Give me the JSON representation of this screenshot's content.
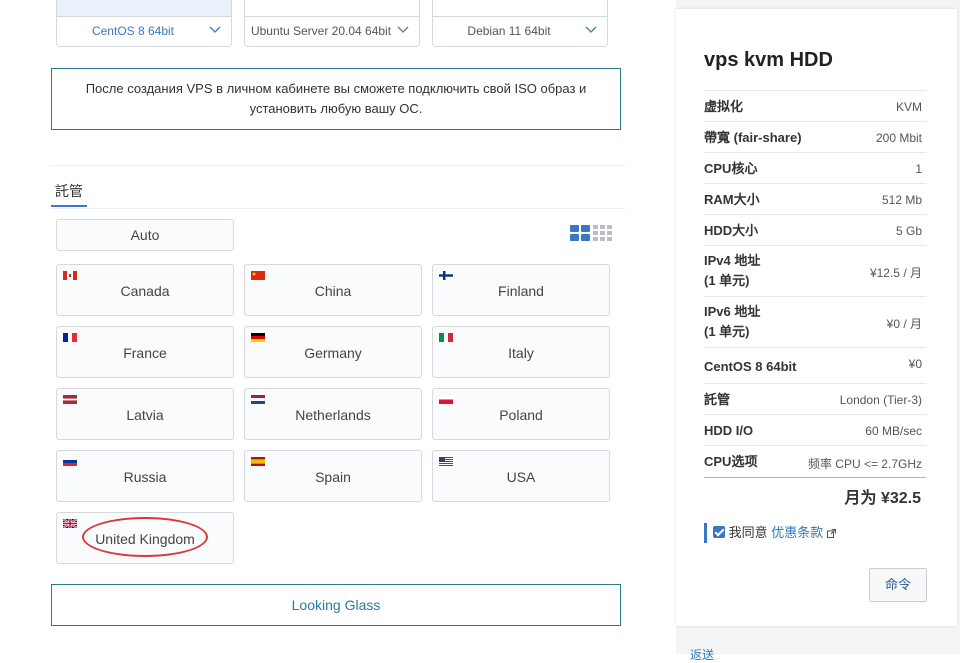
{
  "os_cards": [
    {
      "label": "CentOS 8 64bit",
      "selected": true
    },
    {
      "label": "Ubuntu Server 20.04 64bit",
      "selected": false
    },
    {
      "label": "Debian 11 64bit",
      "selected": false
    }
  ],
  "notice": "После создания VPS в личном кабинете вы сможете подключить свой ISO образ и установить любую вашу ОС.",
  "section_tab": "託管",
  "auto_label": "Auto",
  "locations": [
    {
      "name": "Canada",
      "flag": "canada-flag-icon"
    },
    {
      "name": "China",
      "flag": "china-flag-icon"
    },
    {
      "name": "Finland",
      "flag": "finland-flag-icon"
    },
    {
      "name": "France",
      "flag": "france-flag-icon"
    },
    {
      "name": "Germany",
      "flag": "germany-flag-icon"
    },
    {
      "name": "Italy",
      "flag": "italy-flag-icon"
    },
    {
      "name": "Latvia",
      "flag": "latvia-flag-icon"
    },
    {
      "name": "Netherlands",
      "flag": "netherlands-flag-icon"
    },
    {
      "name": "Poland",
      "flag": "poland-flag-icon"
    },
    {
      "name": "Russia",
      "flag": "russia-flag-icon"
    },
    {
      "name": "Spain",
      "flag": "spain-flag-icon"
    },
    {
      "name": "USA",
      "flag": "usa-flag-icon"
    },
    {
      "name": "United Kingdom",
      "flag": "uk-flag-icon"
    }
  ],
  "looking_glass": "Looking Glass",
  "summary": {
    "title": "vps kvm HDD",
    "rows": [
      {
        "k": "虚拟化",
        "v": "KVM"
      },
      {
        "k": "帶寬 (fair-share)",
        "v": "200 Mbit"
      },
      {
        "k": "CPU核心",
        "v": "1"
      },
      {
        "k": "RAM大小",
        "v": "512 Mb"
      },
      {
        "k": "HDD大小",
        "v": "5 Gb"
      },
      {
        "k": "IPv4 地址",
        "k2": "(1 单元)",
        "v": "¥12.5 / 月"
      },
      {
        "k": "IPv6 地址",
        "k2": "(1 单元)",
        "v": "¥0 / 月"
      },
      {
        "k": "CentOS 8 64bit",
        "v": "¥0"
      },
      {
        "k": "託管",
        "v": "London (Tier-3)"
      },
      {
        "k": "HDD I/O",
        "v": "60 MB/sec"
      },
      {
        "k": "CPU选项",
        "v": "频率 CPU <= 2.7GHz"
      }
    ],
    "total": "月为 ¥32.5",
    "agree_text": "我同意",
    "agree_link": "优惠条款",
    "order_button": "命令"
  },
  "back_link": "返送",
  "colors": {
    "accent": "#3b77c4",
    "teal_border": "#2c7d87",
    "highlight_circle": "#d9393a"
  }
}
